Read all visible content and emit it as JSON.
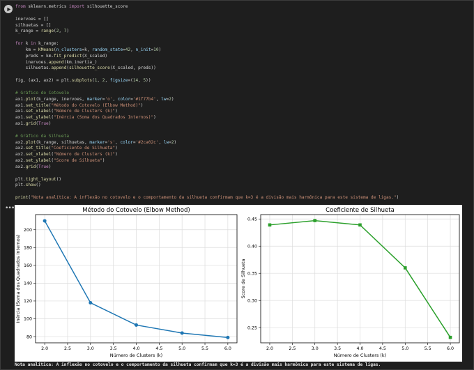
{
  "code_lines": [
    [
      [
        "k",
        "from "
      ],
      [
        "t",
        "sklearn.metrics "
      ],
      [
        "k",
        "import "
      ],
      [
        "t",
        "silhouette_score"
      ]
    ],
    [],
    [
      [
        "t",
        "inervoes = []"
      ]
    ],
    [
      [
        "t",
        "silhuetas = []"
      ]
    ],
    [
      [
        "t",
        "k_range = "
      ],
      [
        "f",
        "range"
      ],
      [
        "t",
        "("
      ],
      [
        "n",
        "2"
      ],
      [
        "t",
        ", "
      ],
      [
        "n",
        "7"
      ],
      [
        "t",
        ")"
      ]
    ],
    [],
    [
      [
        "k",
        "for "
      ],
      [
        "t",
        "k "
      ],
      [
        "k",
        "in "
      ],
      [
        "t",
        "k_range:"
      ]
    ],
    [
      [
        "t",
        "    km = "
      ],
      [
        "f",
        "KMeans"
      ],
      [
        "t",
        "("
      ],
      [
        "v",
        "n_clusters"
      ],
      [
        "t",
        "=k, "
      ],
      [
        "v",
        "random_state"
      ],
      [
        "t",
        "="
      ],
      [
        "n",
        "42"
      ],
      [
        "t",
        ", "
      ],
      [
        "v",
        "n_init"
      ],
      [
        "t",
        "="
      ],
      [
        "n",
        "10"
      ],
      [
        "t",
        ")"
      ]
    ],
    [
      [
        "t",
        "    preds = km."
      ],
      [
        "f",
        "fit_predict"
      ],
      [
        "t",
        "(X_scaled)"
      ]
    ],
    [
      [
        "t",
        "    inervoes."
      ],
      [
        "f",
        "append"
      ],
      [
        "t",
        "(km.inertia_)"
      ]
    ],
    [
      [
        "t",
        "    silhuetas."
      ],
      [
        "f",
        "append"
      ],
      [
        "t",
        "("
      ],
      [
        "f",
        "silhouette_score"
      ],
      [
        "t",
        "(X_scaled, preds))"
      ]
    ],
    [],
    [
      [
        "t",
        "fig, (ax1, ax2) = plt."
      ],
      [
        "f",
        "subplots"
      ],
      [
        "t",
        "("
      ],
      [
        "n",
        "1"
      ],
      [
        "t",
        ", "
      ],
      [
        "n",
        "2"
      ],
      [
        "t",
        ", "
      ],
      [
        "v",
        "figsize"
      ],
      [
        "t",
        "=("
      ],
      [
        "n",
        "14"
      ],
      [
        "t",
        ", "
      ],
      [
        "n",
        "5"
      ],
      [
        "t",
        "))"
      ]
    ],
    [],
    [
      [
        "c",
        "# Gráfico do Cotovelo"
      ]
    ],
    [
      [
        "t",
        "ax1."
      ],
      [
        "f",
        "plot"
      ],
      [
        "t",
        "(k_range, inervoes, "
      ],
      [
        "v",
        "marker"
      ],
      [
        "t",
        "="
      ],
      [
        "s",
        "'o'"
      ],
      [
        "t",
        ", "
      ],
      [
        "v",
        "color"
      ],
      [
        "t",
        "="
      ],
      [
        "s",
        "'#1f77b4'"
      ],
      [
        "t",
        ", "
      ],
      [
        "v",
        "lw"
      ],
      [
        "t",
        "="
      ],
      [
        "n",
        "2"
      ],
      [
        "t",
        ")"
      ]
    ],
    [
      [
        "t",
        "ax1."
      ],
      [
        "f",
        "set_title"
      ],
      [
        "t",
        "("
      ],
      [
        "s",
        "\"Método do Cotovelo (Elbow Method)\""
      ],
      [
        "t",
        ")"
      ]
    ],
    [
      [
        "t",
        "ax1."
      ],
      [
        "f",
        "set_xlabel"
      ],
      [
        "t",
        "("
      ],
      [
        "s",
        "\"Número de Clusters (k)\""
      ],
      [
        "t",
        ")"
      ]
    ],
    [
      [
        "t",
        "ax1."
      ],
      [
        "f",
        "set_ylabel"
      ],
      [
        "t",
        "("
      ],
      [
        "s",
        "\"Inércia (Soma dos Quadrados Internos)\""
      ],
      [
        "t",
        ")"
      ]
    ],
    [
      [
        "t",
        "ax1."
      ],
      [
        "f",
        "grid"
      ],
      [
        "t",
        "("
      ],
      [
        "k",
        "True"
      ],
      [
        "t",
        ")"
      ]
    ],
    [],
    [
      [
        "c",
        "# Gráfico da Silhueta"
      ]
    ],
    [
      [
        "t",
        "ax2."
      ],
      [
        "f",
        "plot"
      ],
      [
        "t",
        "(k_range, silhuetas, "
      ],
      [
        "v",
        "marker"
      ],
      [
        "t",
        "="
      ],
      [
        "s",
        "'s'"
      ],
      [
        "t",
        ", "
      ],
      [
        "v",
        "color"
      ],
      [
        "t",
        "="
      ],
      [
        "s",
        "'#2ca02c'"
      ],
      [
        "t",
        ", "
      ],
      [
        "v",
        "lw"
      ],
      [
        "t",
        "="
      ],
      [
        "n",
        "2"
      ],
      [
        "t",
        ")"
      ]
    ],
    [
      [
        "t",
        "ax2."
      ],
      [
        "f",
        "set_title"
      ],
      [
        "t",
        "("
      ],
      [
        "s",
        "\"Coeficiente de Silhueta\""
      ],
      [
        "t",
        ")"
      ]
    ],
    [
      [
        "t",
        "ax2."
      ],
      [
        "f",
        "set_xlabel"
      ],
      [
        "t",
        "("
      ],
      [
        "s",
        "\"Número de Clusters (k)\""
      ],
      [
        "t",
        ")"
      ]
    ],
    [
      [
        "t",
        "ax2."
      ],
      [
        "f",
        "set_ylabel"
      ],
      [
        "t",
        "("
      ],
      [
        "s",
        "\"Score de Silhueta\""
      ],
      [
        "t",
        ")"
      ]
    ],
    [
      [
        "t",
        "ax2."
      ],
      [
        "f",
        "grid"
      ],
      [
        "t",
        "("
      ],
      [
        "k",
        "True"
      ],
      [
        "t",
        ")"
      ]
    ],
    [],
    [
      [
        "t",
        "plt."
      ],
      [
        "f",
        "tight_layout"
      ],
      [
        "t",
        "()"
      ]
    ],
    [
      [
        "t",
        "plt."
      ],
      [
        "f",
        "show"
      ],
      [
        "t",
        "()"
      ]
    ],
    [],
    [
      [
        "f",
        "print"
      ],
      [
        "t",
        "("
      ],
      [
        "s",
        "\"Nota analítica: A inflexão no cotovelo e o comportamento da silhueta confirmam que k=3 é a divisão mais harmônica para este sistema de ligas.\""
      ],
      [
        "t",
        ")"
      ]
    ]
  ],
  "output_menu": "•••",
  "print_output": "Nota analítica: A inflexão no cotovelo e o comportamento da silhueta confirmam que k=3 é a divisão mais harmônica para este sistema de ligas.",
  "colors": {
    "keyword": "#c586c0",
    "function": "#dcdcaa",
    "string": "#ce9178",
    "number": "#b5cea8",
    "comment": "#6a9955",
    "param": "#9cdcfe",
    "text": "#d4d4d4",
    "series1": "#1f77b4",
    "series2": "#2ca02c"
  },
  "chart_data": [
    {
      "type": "line",
      "title": "Método do Cotovelo (Elbow Method)",
      "xlabel": "Número de Clusters (k)",
      "ylabel": "Inércia (Soma dos Quadrados Internos)",
      "x": [
        2,
        3,
        4,
        5,
        6
      ],
      "series": [
        {
          "values": [
            210,
            118,
            93,
            84,
            79
          ],
          "color": "#1f77b4",
          "marker": "circle"
        }
      ],
      "xlim": [
        1.8,
        6.2
      ],
      "ylim": [
        73,
        217
      ],
      "xticks": [
        "2.0",
        "2.5",
        "3.0",
        "3.5",
        "4.0",
        "4.5",
        "5.0",
        "5.5",
        "6.0"
      ],
      "yticks": [
        "80",
        "100",
        "120",
        "140",
        "160",
        "180",
        "200"
      ],
      "grid": true
    },
    {
      "type": "line",
      "title": "Coeficiente de Silhueta",
      "xlabel": "Número de Clusters (k)",
      "ylabel": "Score de Silhueta",
      "x": [
        2,
        3,
        4,
        5,
        6
      ],
      "series": [
        {
          "values": [
            0.439,
            0.447,
            0.439,
            0.36,
            0.232
          ],
          "color": "#2ca02c",
          "marker": "square"
        }
      ],
      "xlim": [
        1.8,
        6.2
      ],
      "ylim": [
        0.222,
        0.458
      ],
      "xticks": [
        "2.0",
        "2.5",
        "3.0",
        "3.5",
        "4.0",
        "4.5",
        "5.0",
        "5.5",
        "6.0"
      ],
      "yticks": [
        "0.25",
        "0.30",
        "0.35",
        "0.40",
        "0.45"
      ],
      "grid": true
    }
  ]
}
